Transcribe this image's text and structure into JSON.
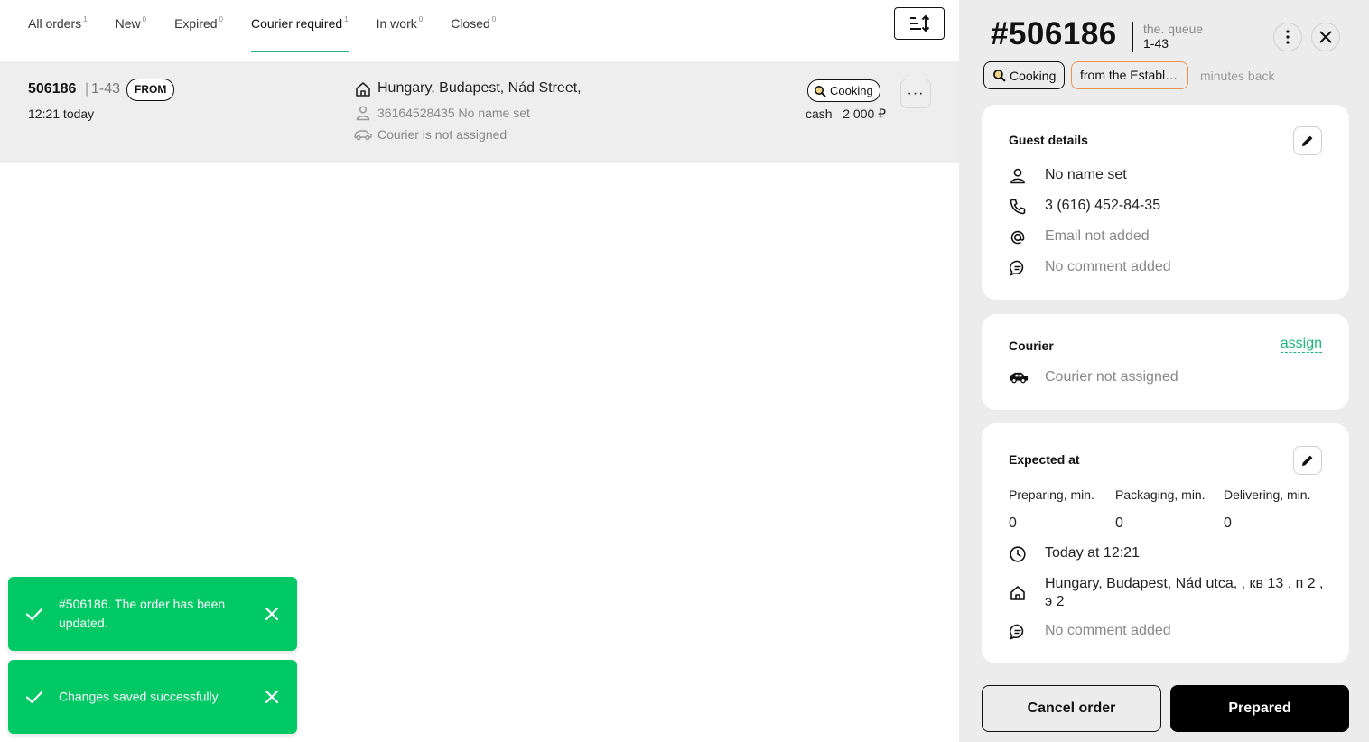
{
  "tabs": [
    {
      "label": "All orders",
      "count": "1"
    },
    {
      "label": "New",
      "count": "0"
    },
    {
      "label": "Expired",
      "count": "0"
    },
    {
      "label": "Courier required",
      "count": "1",
      "active": true
    },
    {
      "label": "In work",
      "count": "0"
    },
    {
      "label": "Closed",
      "count": "0"
    }
  ],
  "sort_button_icon": "sort-icon",
  "order": {
    "number": "506186",
    "separator": "|",
    "queue": "1-43",
    "badge": "FROM",
    "time": "12:21 today",
    "address": "Hungary, Budapest, Nád Street,",
    "phone_line": "36164528435 No name set",
    "courier_line": "Courier is not assigned",
    "status": "Cooking",
    "payment": "cash   2 000 ₽",
    "more": "···"
  },
  "toasts": [
    {
      "message": "#506186. The order has been updated."
    },
    {
      "message": "Changes saved successfully"
    }
  ],
  "detail": {
    "number": "#506186",
    "queue_label": "the. queue",
    "queue_value": "1-43",
    "status": "Cooking",
    "source": "from the Establishment",
    "minutes": "minutes back",
    "guest": {
      "title": "Guest details",
      "name": "No name set",
      "phone": "3 (616) 452-84-35",
      "email": "Email not added",
      "comment": "No comment added"
    },
    "courier": {
      "title": "Courier",
      "assign": "assign",
      "status": "Courier not assigned"
    },
    "expected": {
      "title": "Expected at",
      "preparing_label": "Preparing, min.",
      "packaging_label": "Packaging, min.",
      "delivering_label": "Delivering, min.",
      "preparing_value": "0",
      "packaging_value": "0",
      "delivering_value": "0",
      "time": "Today at 12:21",
      "address": "Hungary, Budapest, Nád utca, , кв 13 , п 2 , э 2",
      "comment": "No comment added"
    },
    "cancel_label": "Cancel order",
    "prepared_label": "Prepared"
  },
  "colors": {
    "accent_green": "#1fb37a",
    "toast_green": "#00c865",
    "source_orange": "#e89450"
  }
}
